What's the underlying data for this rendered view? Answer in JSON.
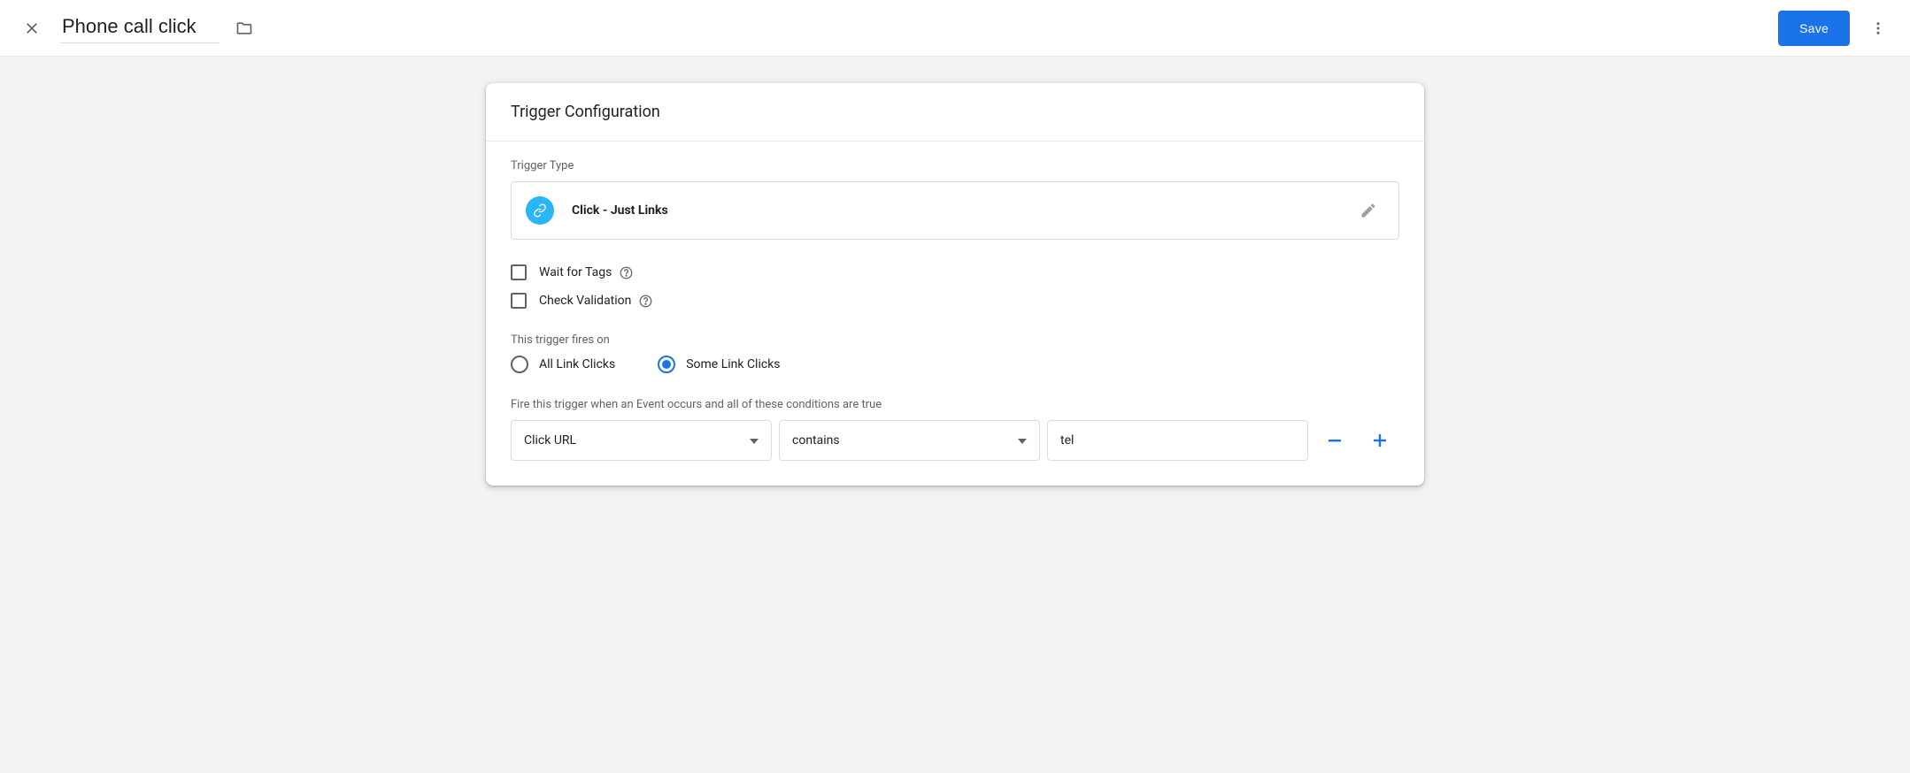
{
  "header": {
    "title_value": "Phone call click",
    "save_label": "Save"
  },
  "card": {
    "title": "Trigger Configuration",
    "trigger_type_section_label": "Trigger Type",
    "trigger_type_value": "Click - Just Links",
    "options": {
      "wait_for_tags_label": "Wait for Tags",
      "wait_for_tags_checked": false,
      "check_validation_label": "Check Validation",
      "check_validation_checked": false
    },
    "fires_on_label": "This trigger fires on",
    "radios": {
      "all_label": "All Link Clicks",
      "some_label": "Some Link Clicks",
      "selected": "some"
    },
    "conditions_desc": "Fire this trigger when an Event occurs and all of these conditions are true",
    "condition": {
      "variable": "Click URL",
      "operator": "contains",
      "value": "tel"
    }
  }
}
